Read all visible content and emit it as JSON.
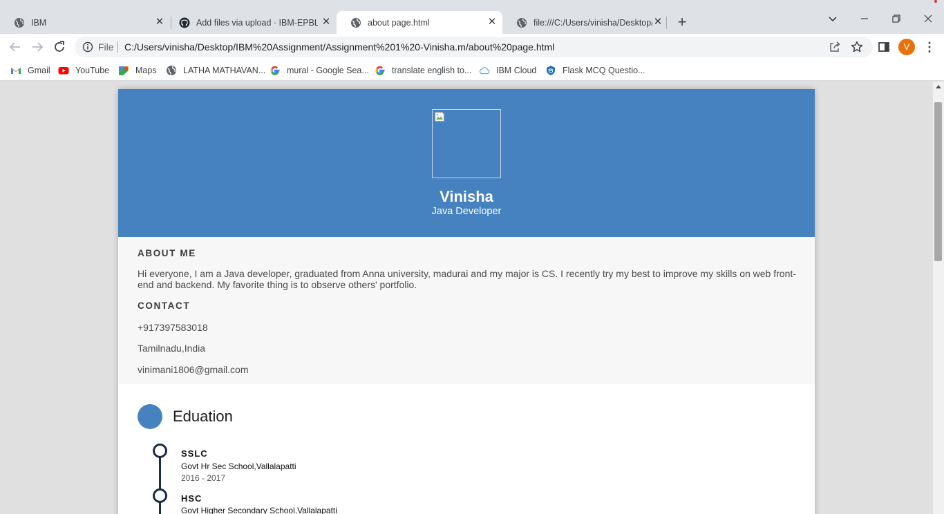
{
  "tabs": [
    {
      "title": "IBM"
    },
    {
      "title": "Add files via upload · IBM-EPBL/I"
    },
    {
      "title": "about page.html"
    },
    {
      "title": "file:///C:/Users/vinisha/Desktop/I"
    }
  ],
  "toolbar": {
    "scheme": "File",
    "url": "C:/Users/vinisha/Desktop/IBM%20Assignment/Assignment%201%20-Vinisha.m/about%20page.html",
    "avatar_letter": "V"
  },
  "bookmarks": [
    {
      "label": "Gmail",
      "icon": "gmail-icon"
    },
    {
      "label": "YouTube",
      "icon": "youtube-icon"
    },
    {
      "label": "Maps",
      "icon": "maps-icon"
    },
    {
      "label": "LATHA MATHAVAN...",
      "icon": "globe-icon"
    },
    {
      "label": "mural - Google Sea...",
      "icon": "google-icon"
    },
    {
      "label": "translate english to...",
      "icon": "google-icon"
    },
    {
      "label": "IBM Cloud",
      "icon": "cloud-icon"
    },
    {
      "label": "Flask MCQ Questio...",
      "icon": "shield-icon"
    }
  ],
  "profile": {
    "name": "Vinisha",
    "role": "Java Developer"
  },
  "about": {
    "heading": "ABOUT ME",
    "text": "Hi everyone, I am a Java developer, graduated from Anna university, madurai and my major is CS. I recently try my best to improve my skills on web front-end and backend. My favorite thing is to observe others' portfolio."
  },
  "contact": {
    "heading": "CONTACT",
    "phone": "+917397583018",
    "location": "Tamilnadu,India",
    "email": "vinimani1806@gmail.com"
  },
  "education": {
    "title": "Eduation",
    "items": [
      {
        "level": "SSLC",
        "school": "Govt Hr Sec School,Vallalapatti",
        "years": "2016 - 2017"
      },
      {
        "level": "HSC",
        "school": "Govt Higher Secondary School,Vallalapatti",
        "years": ""
      }
    ]
  },
  "colors": {
    "accent": "#4682bf",
    "timeline": "#1a2b44",
    "avatar": "#e8710a"
  }
}
